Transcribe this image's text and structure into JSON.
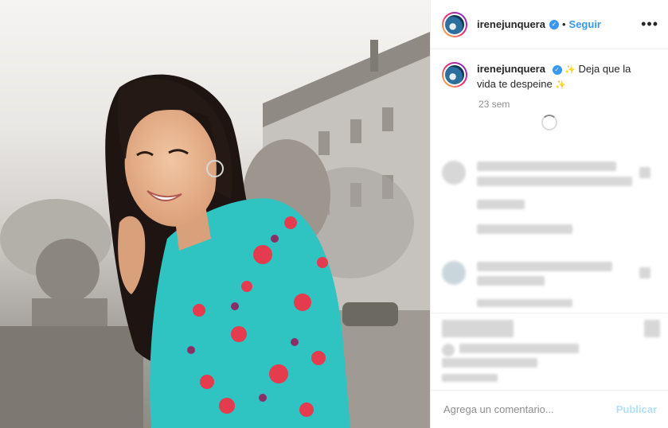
{
  "header": {
    "username": "irenejunquera",
    "separator": "•",
    "follow_label": "Seguir",
    "more_icon": "ellipsis-icon"
  },
  "caption": {
    "username": "irenejunquera",
    "text": "Deja que la vida te despeine",
    "sparkle": "✨",
    "time": "23 sem"
  },
  "footer": {
    "comment_placeholder": "Agrega un comentario...",
    "publish_label": "Publicar"
  },
  "colors": {
    "link": "#3897f0",
    "publish_disabled": "#b2dffc",
    "muted": "#8e8e8e",
    "shirt": "#2fc3c2",
    "flower": "#e43b4f"
  }
}
